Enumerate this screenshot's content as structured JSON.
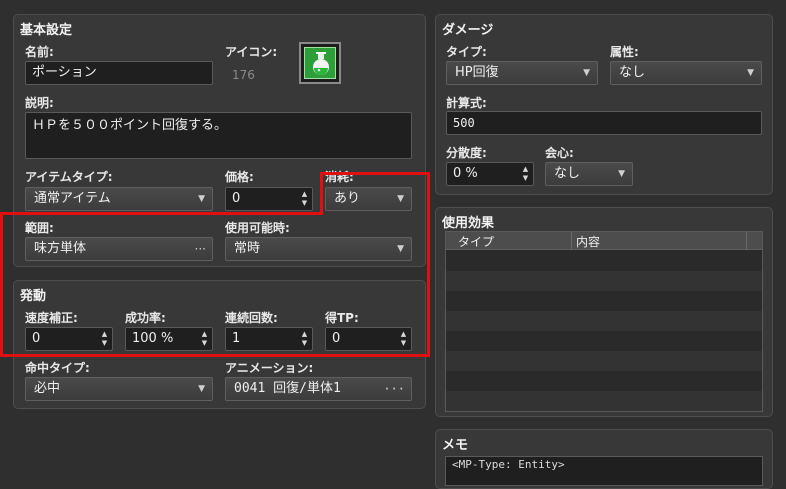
{
  "basic": {
    "title": "基本設定",
    "name_label": "名前:",
    "name_value": "ポーション",
    "icon_label": "アイコン:",
    "icon_index": "176",
    "icon_name": "potion-icon",
    "description_label": "説明:",
    "description_value": "ＨＰを５００ポイント回復する。",
    "item_type_label": "アイテムタイプ:",
    "item_type_value": "通常アイテム",
    "price_label": "価格:",
    "price_value": "0",
    "consumable_label": "消耗:",
    "consumable_value": "あり",
    "scope_label": "範囲:",
    "scope_value": "味方単体",
    "occasion_label": "使用可能時:",
    "occasion_value": "常時"
  },
  "invocation": {
    "title": "発動",
    "speed_label": "速度補正:",
    "speed_value": "0",
    "success_label": "成功率:",
    "success_value": "100 %",
    "repeat_label": "連続回数:",
    "repeat_value": "1",
    "tp_label": "得TP:",
    "tp_value": "0",
    "hit_type_label": "命中タイプ:",
    "hit_type_value": "必中",
    "animation_label": "アニメーション:",
    "animation_value": "0041 回復/単体1"
  },
  "damage": {
    "title": "ダメージ",
    "type_label": "タイプ:",
    "type_value": "HP回復",
    "element_label": "属性:",
    "element_value": "なし",
    "formula_label": "計算式:",
    "formula_value": "500",
    "variance_label": "分散度:",
    "variance_value": "0 %",
    "critical_label": "会心:",
    "critical_value": "なし"
  },
  "effects": {
    "title": "使用効果",
    "columns": [
      "タイプ",
      "内容"
    ]
  },
  "memo": {
    "title": "メモ",
    "value": "<MP-Type: Entity>"
  },
  "colors": {
    "highlight": "#e01010",
    "panel": "#383838",
    "field": "#1f1f1f"
  }
}
